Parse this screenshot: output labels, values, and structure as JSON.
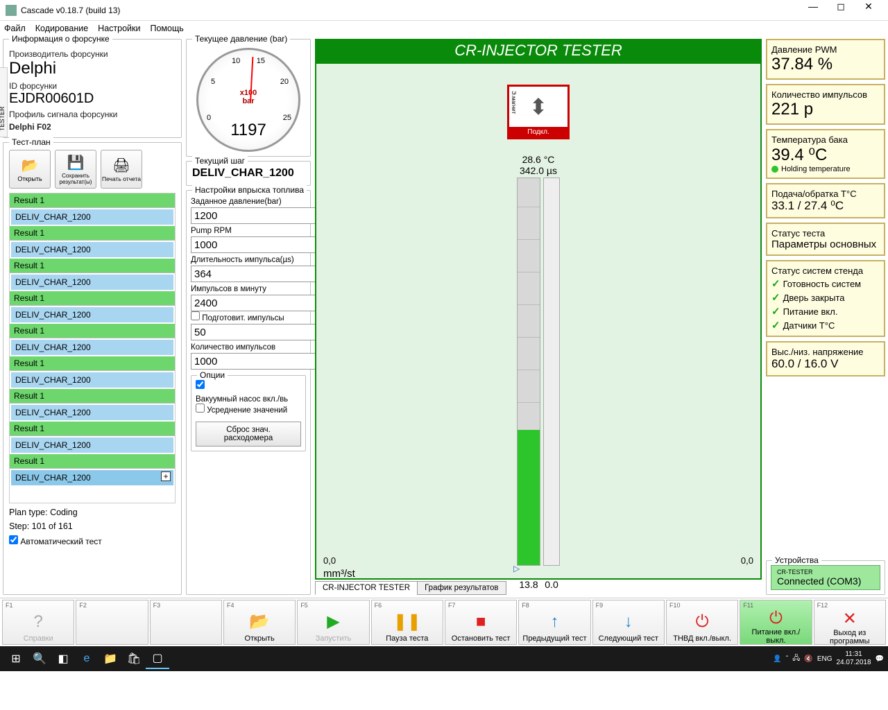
{
  "window": {
    "title": "Cascade v0.18.7 (build 13)"
  },
  "menu": {
    "file": "Файл",
    "coding": "Кодирование",
    "settings": "Настройки",
    "help": "Помощь"
  },
  "sidebar_tab": "CR-INJECTOR TESTER",
  "injector_info": {
    "group": "Информация о форсунке",
    "mfr_lbl": "Производитель форсунки",
    "mfr": "Delphi",
    "id_lbl": "ID форсунки",
    "id": "EJDR00601D",
    "profile_lbl": "Профиль сигнала форсунки",
    "profile": "Delphi F02"
  },
  "testplan": {
    "group": "Тест-план",
    "open": "Открыть",
    "save": "Сохранить результат(ы)",
    "print": "Печать отчета",
    "items": [
      {
        "hdr": "Result 1",
        "name": "DELIV_CHAR_1200"
      },
      {
        "hdr": "Result 1",
        "name": "DELIV_CHAR_1200"
      },
      {
        "hdr": "Result 1",
        "name": "DELIV_CHAR_1200"
      },
      {
        "hdr": "Result 1",
        "name": "DELIV_CHAR_1200"
      },
      {
        "hdr": "Result 1",
        "name": "DELIV_CHAR_1200"
      },
      {
        "hdr": "Result 1",
        "name": "DELIV_CHAR_1200"
      },
      {
        "hdr": "Result 1",
        "name": "DELIV_CHAR_1200"
      },
      {
        "hdr": "Result 1",
        "name": "DELIV_CHAR_1200"
      },
      {
        "hdr": "Result 1",
        "name": "DELIV_CHAR_1200",
        "active": true
      }
    ],
    "plan_type": "Plan type:  Coding",
    "step": "Step:  101 of 161",
    "auto": "Автоматический тест"
  },
  "gauge": {
    "group": "Текущее давление (bar)",
    "unit": "x100\nbar",
    "value": "1197"
  },
  "cur_step": {
    "group": "Текущий шаг",
    "value": "DELIV_CHAR_1200"
  },
  "settings": {
    "group": "Настройки впрыска топлива",
    "pressure_lbl": "Заданное давление(bar)",
    "pressure": "1200",
    "rpm_lbl": "Pump RPM",
    "rpm": "1000",
    "pulse_lbl": "Длительность импульса(µs)",
    "pulse": "364",
    "ipm_lbl": "Импульсов в минуту",
    "ipm": "2400",
    "prep_lbl": "Подготовит. импульсы",
    "prep": "50",
    "count_lbl": "Количество импульсов",
    "count": "1000",
    "options": "Опции",
    "vacuum": "Вакуумный насос вкл./вь",
    "avg": "Усреднение значений",
    "reset": "Сброс знач. расходомера"
  },
  "tester": {
    "title": "CR-INJECTOR TESTER",
    "magnet": "Э.магнит",
    "status": "Подкл.",
    "temp": "28.6 °C",
    "pulse": "342.0 µs",
    "bar1": "13.8",
    "bar2": "0.0",
    "zero": "0,0",
    "unit": "mm³/st",
    "tab1": "CR-INJECTOR TESTER",
    "tab2": "График результатов"
  },
  "right": {
    "pwm_lbl": "Давление PWM",
    "pwm": "37.84 %",
    "pulses_lbl": "Количество импульсов",
    "pulses": "221 p",
    "tank_lbl": "Температура бака",
    "tank": "39.4 ⁰C",
    "holding": "Holding temperature",
    "flow_lbl": "Подача/обратка T°C",
    "flow": "33.1 / 27.4 ⁰C",
    "test_status_lbl": "Статус теста",
    "test_status": "Параметры основных",
    "bench_lbl": "Статус систем стенда",
    "s1": "Готовность систем",
    "s2": "Дверь закрыта",
    "s3": "Питание вкл.",
    "s4": "Датчики T°C",
    "volt_lbl": "Выс./низ. напряжение",
    "volt": "60.0 / 16.0 V",
    "devices": "Устройства",
    "dev_name": "CR-TESTER",
    "dev_status": "Connected (COM3)"
  },
  "fkeys": {
    "f1": "Справки",
    "f4": "Открыть",
    "f5": "Запустить",
    "f6": "Пауза теста",
    "f7": "Остановить тест",
    "f8": "Предыдущий тест",
    "f9": "Следующий тест",
    "f10": "ТНВД вкл./выкл.",
    "f11": "Питание вкл./выкл.",
    "f12": "Выход из программы"
  },
  "taskbar": {
    "lang": "ENG",
    "time": "11:31",
    "date": "24.07.2018"
  }
}
